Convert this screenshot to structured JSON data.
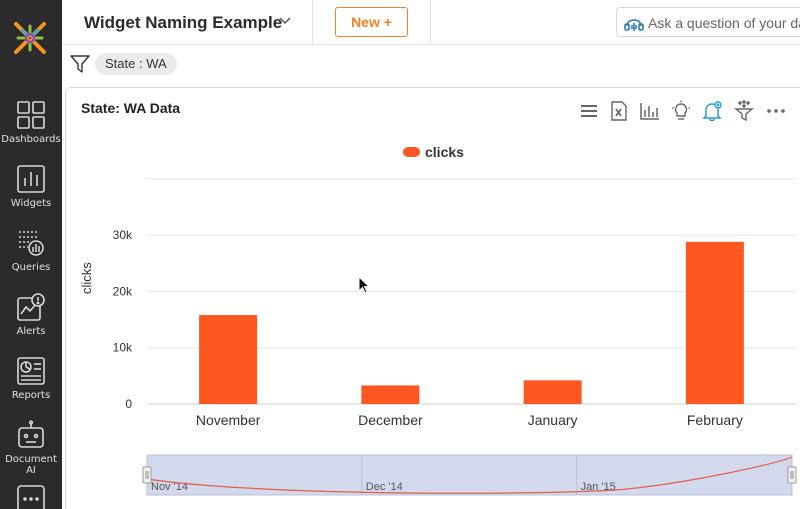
{
  "sidebar": {
    "items": [
      {
        "label": "Dashboards",
        "icon": "dashboards-icon"
      },
      {
        "label": "Widgets",
        "icon": "widgets-icon"
      },
      {
        "label": "Queries",
        "icon": "queries-icon"
      },
      {
        "label": "Alerts",
        "icon": "alerts-icon"
      },
      {
        "label": "Reports",
        "icon": "reports-icon"
      },
      {
        "label": "Document AI",
        "icon": "document-ai-icon"
      },
      {
        "label": "",
        "icon": "more-icon"
      }
    ]
  },
  "header": {
    "title": "Widget Naming Example",
    "new_button": "New +",
    "ask_placeholder": "Ask a question of your da"
  },
  "filter": {
    "chip": "State : WA"
  },
  "widget": {
    "title": "State: WA Data",
    "tools": [
      "menu-icon",
      "excel-export-icon",
      "chart-type-icon",
      "insights-bulb-icon",
      "alert-bell-icon",
      "filter-funnel-icon",
      "more-options-icon"
    ]
  },
  "colors": {
    "accent": "#f0822a",
    "bar": "#fe5722",
    "sidebar_bg": "#2b2b2b",
    "range_fill": "#d3d9ec",
    "range_line": "#e25d4b"
  },
  "chart_data": {
    "type": "bar",
    "legend": [
      "clicks"
    ],
    "ylabel": "clicks",
    "categories": [
      "November",
      "December",
      "January",
      "February"
    ],
    "series": [
      {
        "name": "clicks",
        "values": [
          15800,
          3300,
          4200,
          28800
        ]
      }
    ],
    "yticks": [
      "0",
      "10k",
      "20k",
      "30k"
    ],
    "ylim": [
      0,
      40000
    ],
    "grid": true,
    "legend_position": "top-center",
    "range_selector": {
      "labels": [
        "Nov '14",
        "Dec '14",
        "Jan '15"
      ]
    }
  }
}
